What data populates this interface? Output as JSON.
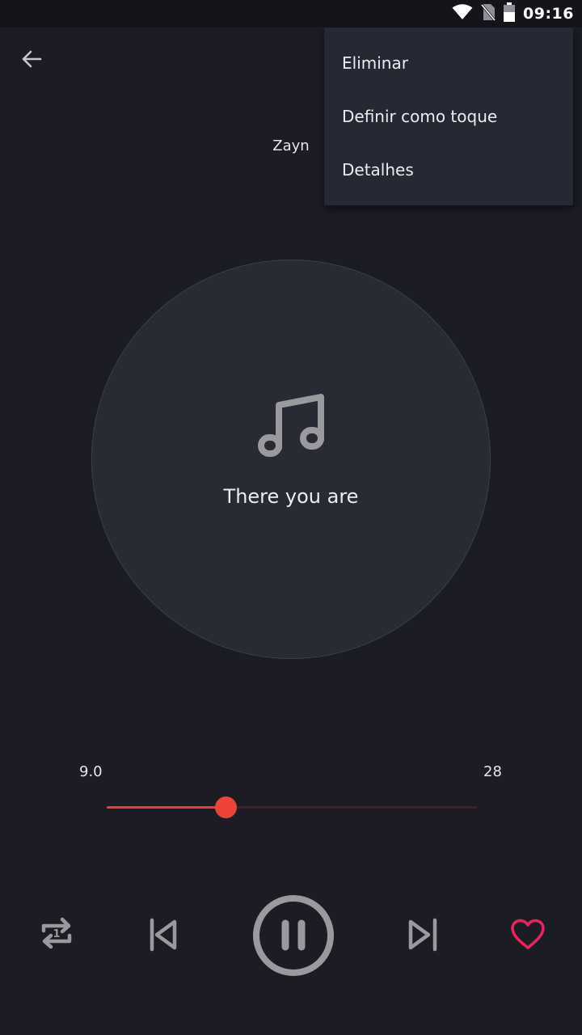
{
  "status_bar": {
    "time": "09:16",
    "icons": [
      "wifi-icon",
      "no-sim-icon",
      "battery-icon"
    ]
  },
  "header": {
    "back_icon": "arrow-left-icon",
    "artist": "Zayn"
  },
  "overflow_menu": {
    "items": [
      {
        "label": "Eliminar"
      },
      {
        "label": "Definir como toque"
      },
      {
        "label": "Detalhes"
      }
    ]
  },
  "now_playing": {
    "art_icon": "music-note-icon",
    "title": "There you are"
  },
  "progress": {
    "current": "9.0",
    "total": "28",
    "fraction": 0.32
  },
  "controls": {
    "repeat_icon": "repeat-one-icon",
    "previous_icon": "skip-previous-icon",
    "play_pause_icon": "pause-icon",
    "next_icon": "skip-next-icon",
    "favorite_icon": "heart-icon"
  },
  "colors": {
    "background": "#1b1c24",
    "accent": "#ee3c32",
    "favorite": "#e8245f",
    "icon": "#9a9a9e"
  }
}
